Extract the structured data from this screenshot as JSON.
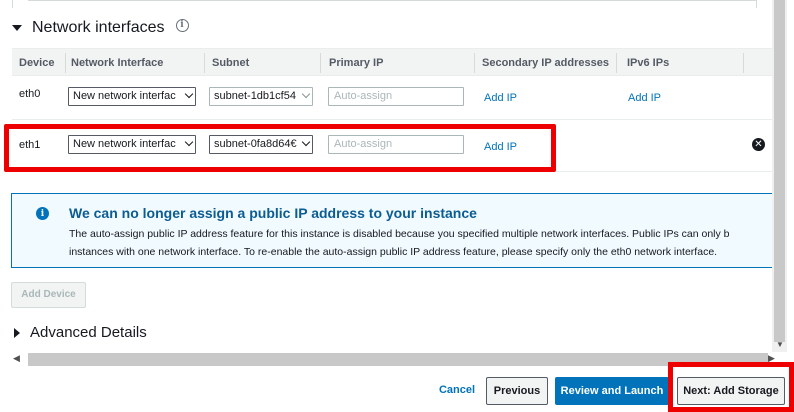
{
  "section": {
    "title": "Network interfaces",
    "info_icon": "info-icon"
  },
  "table": {
    "headers": [
      "Device",
      "Network Interface",
      "Subnet",
      "Primary IP",
      "Secondary IP addresses",
      "IPv6 IPs"
    ],
    "rows": [
      {
        "device": "eth0",
        "network_interface": "New network interfac",
        "subnet": "subnet-1db1cf54",
        "primary_ip_placeholder": "Auto-assign",
        "secondary_ip_link": "Add IP",
        "ipv6_link": "Add IP"
      },
      {
        "device": "eth1",
        "network_interface": "New network interfac",
        "subnet": "subnet-0fa8d64€",
        "primary_ip_placeholder": "Auto-assign",
        "secondary_ip_link": "Add IP",
        "ipv6_link": ""
      }
    ]
  },
  "alert": {
    "title": "We can no longer assign a public IP address to your instance",
    "line1": "The auto-assign public IP address feature for this instance is disabled because you specified multiple network interfaces. Public IPs can only b",
    "line2": "instances with one network interface. To re-enable the auto-assign public IP address feature, please specify only the eth0 network interface."
  },
  "add_device_label": "Add Device",
  "advanced_details_label": "Advanced Details",
  "footer": {
    "cancel": "Cancel",
    "previous": "Previous",
    "review": "Review and Launch",
    "next": "Next: Add Storage"
  },
  "colors": {
    "link": "#0073bb",
    "primary": "#0073bb",
    "highlight": "#ee0000"
  }
}
